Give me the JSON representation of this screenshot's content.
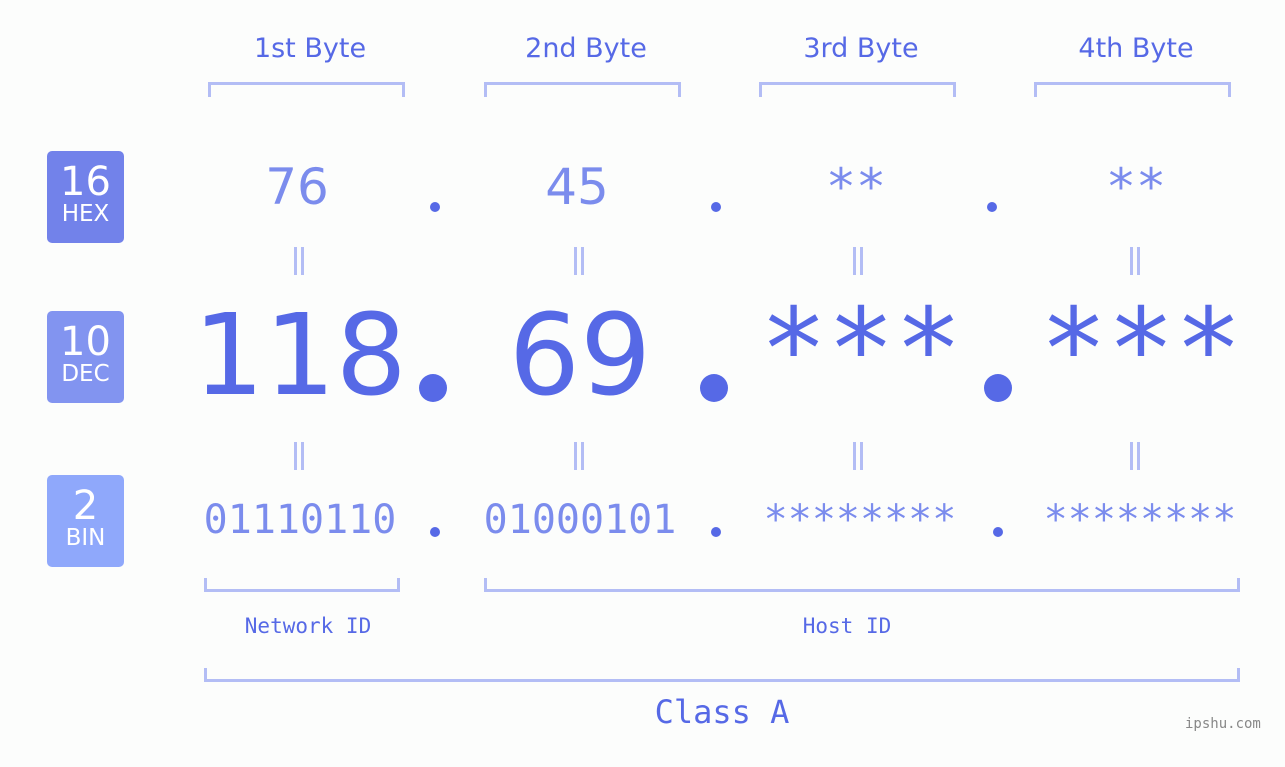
{
  "badges": {
    "hex": {
      "number": "16",
      "label": "HEX",
      "color": "#7282ea"
    },
    "dec": {
      "number": "10",
      "label": "DEC",
      "color": "#8294f0"
    },
    "bin": {
      "number": "2",
      "label": "BIN",
      "color": "#8fa8fb"
    }
  },
  "byte_headers": [
    "1st Byte",
    "2nd Byte",
    "3rd Byte",
    "4th Byte"
  ],
  "hex_values": [
    "76",
    "45",
    "**",
    "**"
  ],
  "dec_values": [
    "118",
    "69",
    "***",
    "***"
  ],
  "bin_values": [
    "01110110",
    "01000101",
    "********",
    "********"
  ],
  "labels": {
    "network_id": "Network ID",
    "host_id": "Host ID",
    "class": "Class A"
  },
  "watermark": "ipshu.com",
  "colors": {
    "primary": "#5669e6",
    "secondary": "#7b8ced",
    "bracket": "#b3bdf5"
  }
}
